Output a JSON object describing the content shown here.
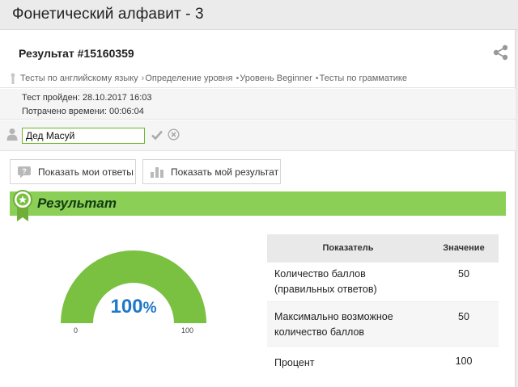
{
  "window": {
    "title": "Фонетический алфавит - 3"
  },
  "result": {
    "title": "Результат #15160359"
  },
  "breadcrumb": {
    "items": [
      "Тесты по английскому языку",
      "Определение уровня",
      "Уровень Beginner",
      "Тесты по грамматике"
    ]
  },
  "meta": {
    "passed": "Тест пройден: 28.10.2017 16:03",
    "time_spent": "Потрачено времени: 00:06:04"
  },
  "name_field": {
    "value": "Дед Масуй"
  },
  "buttons": {
    "show_answers": "Показать мои ответы",
    "show_result": "Показать мой результат"
  },
  "section": {
    "title": "Результат"
  },
  "gauge": {
    "value": "100",
    "unit": "%",
    "min": "0",
    "max": "100",
    "fraction": 1.0
  },
  "results_table": {
    "headers": [
      "Показатель",
      "Значение"
    ],
    "rows": [
      {
        "label": "Количество баллов (правильных ответов)",
        "value": "50"
      },
      {
        "label": "Максимально возможное количество баллов",
        "value": "50"
      },
      {
        "label": "Процент",
        "value": "100"
      }
    ]
  },
  "colors": {
    "accent_green": "#8ccf56",
    "gauge_green": "#7ac142",
    "percent_blue": "#1f78c8"
  },
  "icons": {
    "share": "share-icon",
    "breadcrumb": "pin-icon",
    "user": "user-icon",
    "confirm": "checkmark-icon",
    "cancel": "close-circle-icon",
    "answers": "question-bubble-icon",
    "result": "bar-chart-icon",
    "section": "award-badge-icon"
  }
}
